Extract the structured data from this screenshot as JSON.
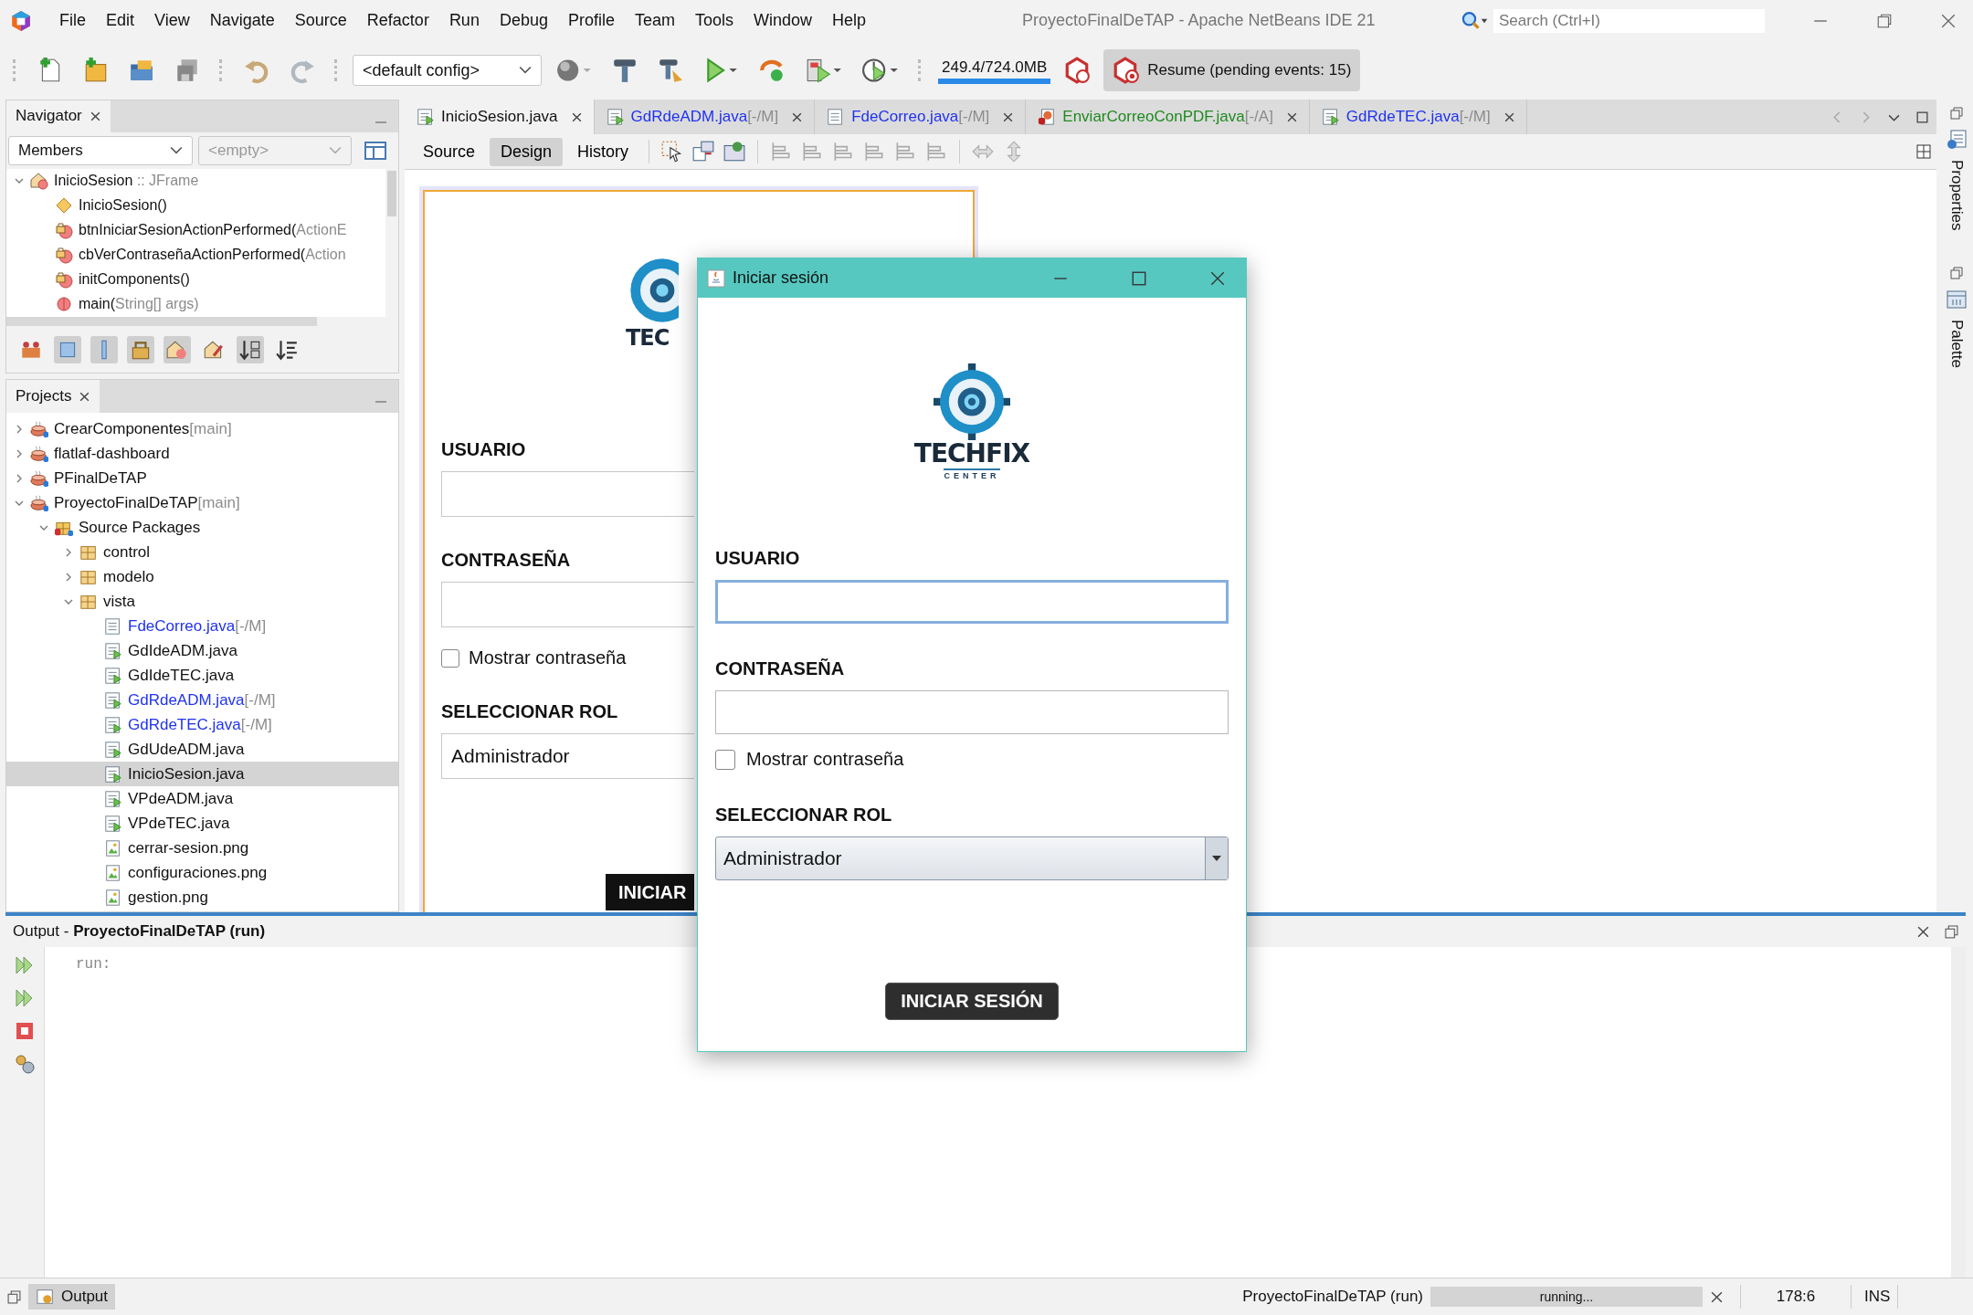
{
  "menu": [
    "File",
    "Edit",
    "View",
    "Navigate",
    "Source",
    "Refactor",
    "Run",
    "Debug",
    "Profile",
    "Team",
    "Tools",
    "Window",
    "Help"
  ],
  "window_title": "ProyectoFinalDeTAP - Apache NetBeans IDE 21",
  "search": {
    "placeholder": "Search (Ctrl+I)"
  },
  "toolbar": {
    "config": "<default config>",
    "memory": "249.4/724.0MB",
    "resume": "Resume (pending events: 15)"
  },
  "navigator": {
    "title": "Navigator",
    "filter": "Members",
    "filter_2": "<empty>",
    "tree": [
      {
        "kind": "class",
        "name": "InicioSesion",
        "detail": " :: JFrame",
        "expanded": true,
        "selected": false,
        "children": [
          {
            "kind": "constructor",
            "name": "InicioSesion()",
            "selected": false
          },
          {
            "kind": "private-method",
            "name": "btnIniciarSesionActionPerformed(",
            "detail": "ActionE",
            "selected": false
          },
          {
            "kind": "private-method",
            "name": "cbVerContraseñaActionPerformed(",
            "detail": "Action",
            "selected": false
          },
          {
            "kind": "private-method",
            "name": "initComponents()",
            "selected": false
          },
          {
            "kind": "static-method",
            "name": "main(",
            "detail": "String[] args)",
            "selected": false
          }
        ]
      }
    ]
  },
  "projects": {
    "title": "Projects",
    "tree": [
      {
        "kind": "project",
        "name": "CrearComponentes",
        "tag": "[main]",
        "expanded": false,
        "selected": false
      },
      {
        "kind": "project",
        "name": "flatlaf-dashboard",
        "expanded": false,
        "selected": false
      },
      {
        "kind": "project",
        "name": "PFinalDeTAP",
        "expanded": false,
        "selected": false
      },
      {
        "kind": "project",
        "name": "ProyectoFinalDeTAP",
        "tag": "[main]",
        "expanded": true,
        "selected": false,
        "children": [
          {
            "kind": "source-folder",
            "name": "Source Packages",
            "expanded": true,
            "selected": false,
            "children": [
              {
                "kind": "package",
                "name": "control",
                "expanded": false,
                "selected": false
              },
              {
                "kind": "package",
                "name": "modelo",
                "expanded": false,
                "selected": false
              },
              {
                "kind": "package",
                "name": "vista",
                "expanded": true,
                "selected": false,
                "children": [
                  {
                    "kind": "form-plain",
                    "name": "FdeCorreo.java",
                    "tag": "[-/M]",
                    "color": "#1f32f0",
                    "selected": false
                  },
                  {
                    "kind": "form",
                    "name": "GdIdeADM.java",
                    "selected": false
                  },
                  {
                    "kind": "form",
                    "name": "GdIdeTEC.java",
                    "selected": false
                  },
                  {
                    "kind": "form",
                    "name": "GdRdeADM.java",
                    "tag": "[-/M]",
                    "color": "#1f32f0",
                    "selected": false
                  },
                  {
                    "kind": "form",
                    "name": "GdRdeTEC.java",
                    "tag": "[-/M]",
                    "color": "#1f32f0",
                    "selected": false
                  },
                  {
                    "kind": "form",
                    "name": "GdUdeADM.java",
                    "selected": false
                  },
                  {
                    "kind": "form",
                    "name": "InicioSesion.java",
                    "selected": true
                  },
                  {
                    "kind": "form",
                    "name": "VPdeADM.java",
                    "selected": false
                  },
                  {
                    "kind": "form",
                    "name": "VPdeTEC.java",
                    "selected": false
                  },
                  {
                    "kind": "image",
                    "name": "cerrar-sesion.png",
                    "selected": false
                  },
                  {
                    "kind": "image",
                    "name": "configuraciones.png",
                    "selected": false
                  },
                  {
                    "kind": "image",
                    "name": "gestion.png",
                    "selected": false
                  }
                ]
              }
            ]
          }
        ]
      }
    ]
  },
  "editor_tabs": [
    {
      "kind": "form",
      "label": "InicioSesion.java",
      "selected": true
    },
    {
      "kind": "form",
      "label": "GdRdeADM.java",
      "tag": "[-/M]",
      "color": "#1f32f0",
      "selected": false
    },
    {
      "kind": "form-plain",
      "label": "FdeCorreo.java",
      "tag": "[-/M]",
      "color": "#1f32f0",
      "selected": false
    },
    {
      "kind": "class",
      "label": "EnviarCorreoConPDF.java",
      "tag": "[-/A]",
      "color": "#1f8a1f",
      "selected": false
    },
    {
      "kind": "form",
      "label": "GdRdeTEC.java",
      "tag": "[-/M]",
      "color": "#1f32f0",
      "selected": false
    }
  ],
  "view_tabs": [
    {
      "label": "Source",
      "selected": false
    },
    {
      "label": "Design",
      "selected": true
    },
    {
      "label": "History",
      "selected": false
    }
  ],
  "design_form": {
    "logo_text": "TEC",
    "user_label": "USUARIO",
    "password_label": "CONTRASEÑA",
    "show_password": "Mostrar contraseña",
    "show_password_checked": false,
    "role_label": "SELECCIONAR ROL",
    "role": "Administrador",
    "button": "INICIAR"
  },
  "side_tabs": [
    "Properties",
    "Palette"
  ],
  "dialog": {
    "title": "Iniciar sesión",
    "logo_text": "TECHFIX",
    "logo_subtext": "CENTER",
    "user_label": "USUARIO",
    "password_label": "CONTRASEÑA",
    "show_password": "Mostrar contraseña",
    "show_password_checked": false,
    "role_label": "SELECCIONAR ROL",
    "role": "Administrador",
    "button": "INICIAR SESIÓN"
  },
  "output": {
    "title": "Output - **ProyectoFinalDeTAP (run)**",
    "text": "run:"
  },
  "status_bar": {
    "tab": "Output",
    "task": "ProyectoFinalDeTAP (run)",
    "progress": "running...",
    "level": 1,
    "position": "178:6",
    "mode": "INS"
  }
}
